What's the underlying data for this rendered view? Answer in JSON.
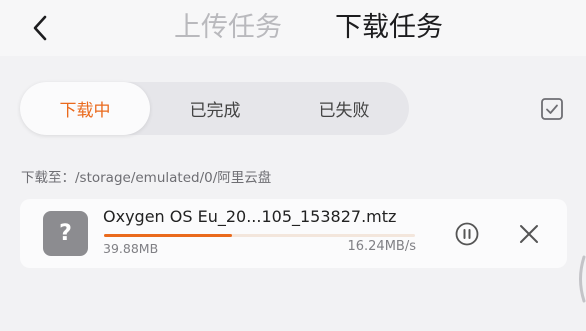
{
  "header": {
    "back_icon": "chevron-left-icon",
    "tabs": [
      {
        "label": "上传任务",
        "active": false
      },
      {
        "label": "下载任务",
        "active": true
      }
    ]
  },
  "filter": {
    "tabs": [
      {
        "label": "下载中",
        "active": true
      },
      {
        "label": "已完成",
        "active": false
      },
      {
        "label": "已失败",
        "active": false
      }
    ],
    "select_icon": "checkbox-icon"
  },
  "download_path": "下载至：/storage/emulated/0/阿里云盘",
  "tasks": [
    {
      "file_name": "Oxygen OS Eu_20...105_153827.mtz",
      "file_icon": "unknown-file-icon",
      "icon_glyph": "?",
      "size": "39.88MB",
      "speed": "16.24MB/s",
      "progress": 0.41,
      "pause_icon": "pause-circle-icon",
      "cancel_icon": "close-icon"
    }
  ],
  "colors": {
    "accent": "#ea6a1d",
    "background": "#f2f2f4",
    "card": "#fbfbfc",
    "muted_text": "#808085",
    "inactive_tab": "#b9b9bd"
  }
}
